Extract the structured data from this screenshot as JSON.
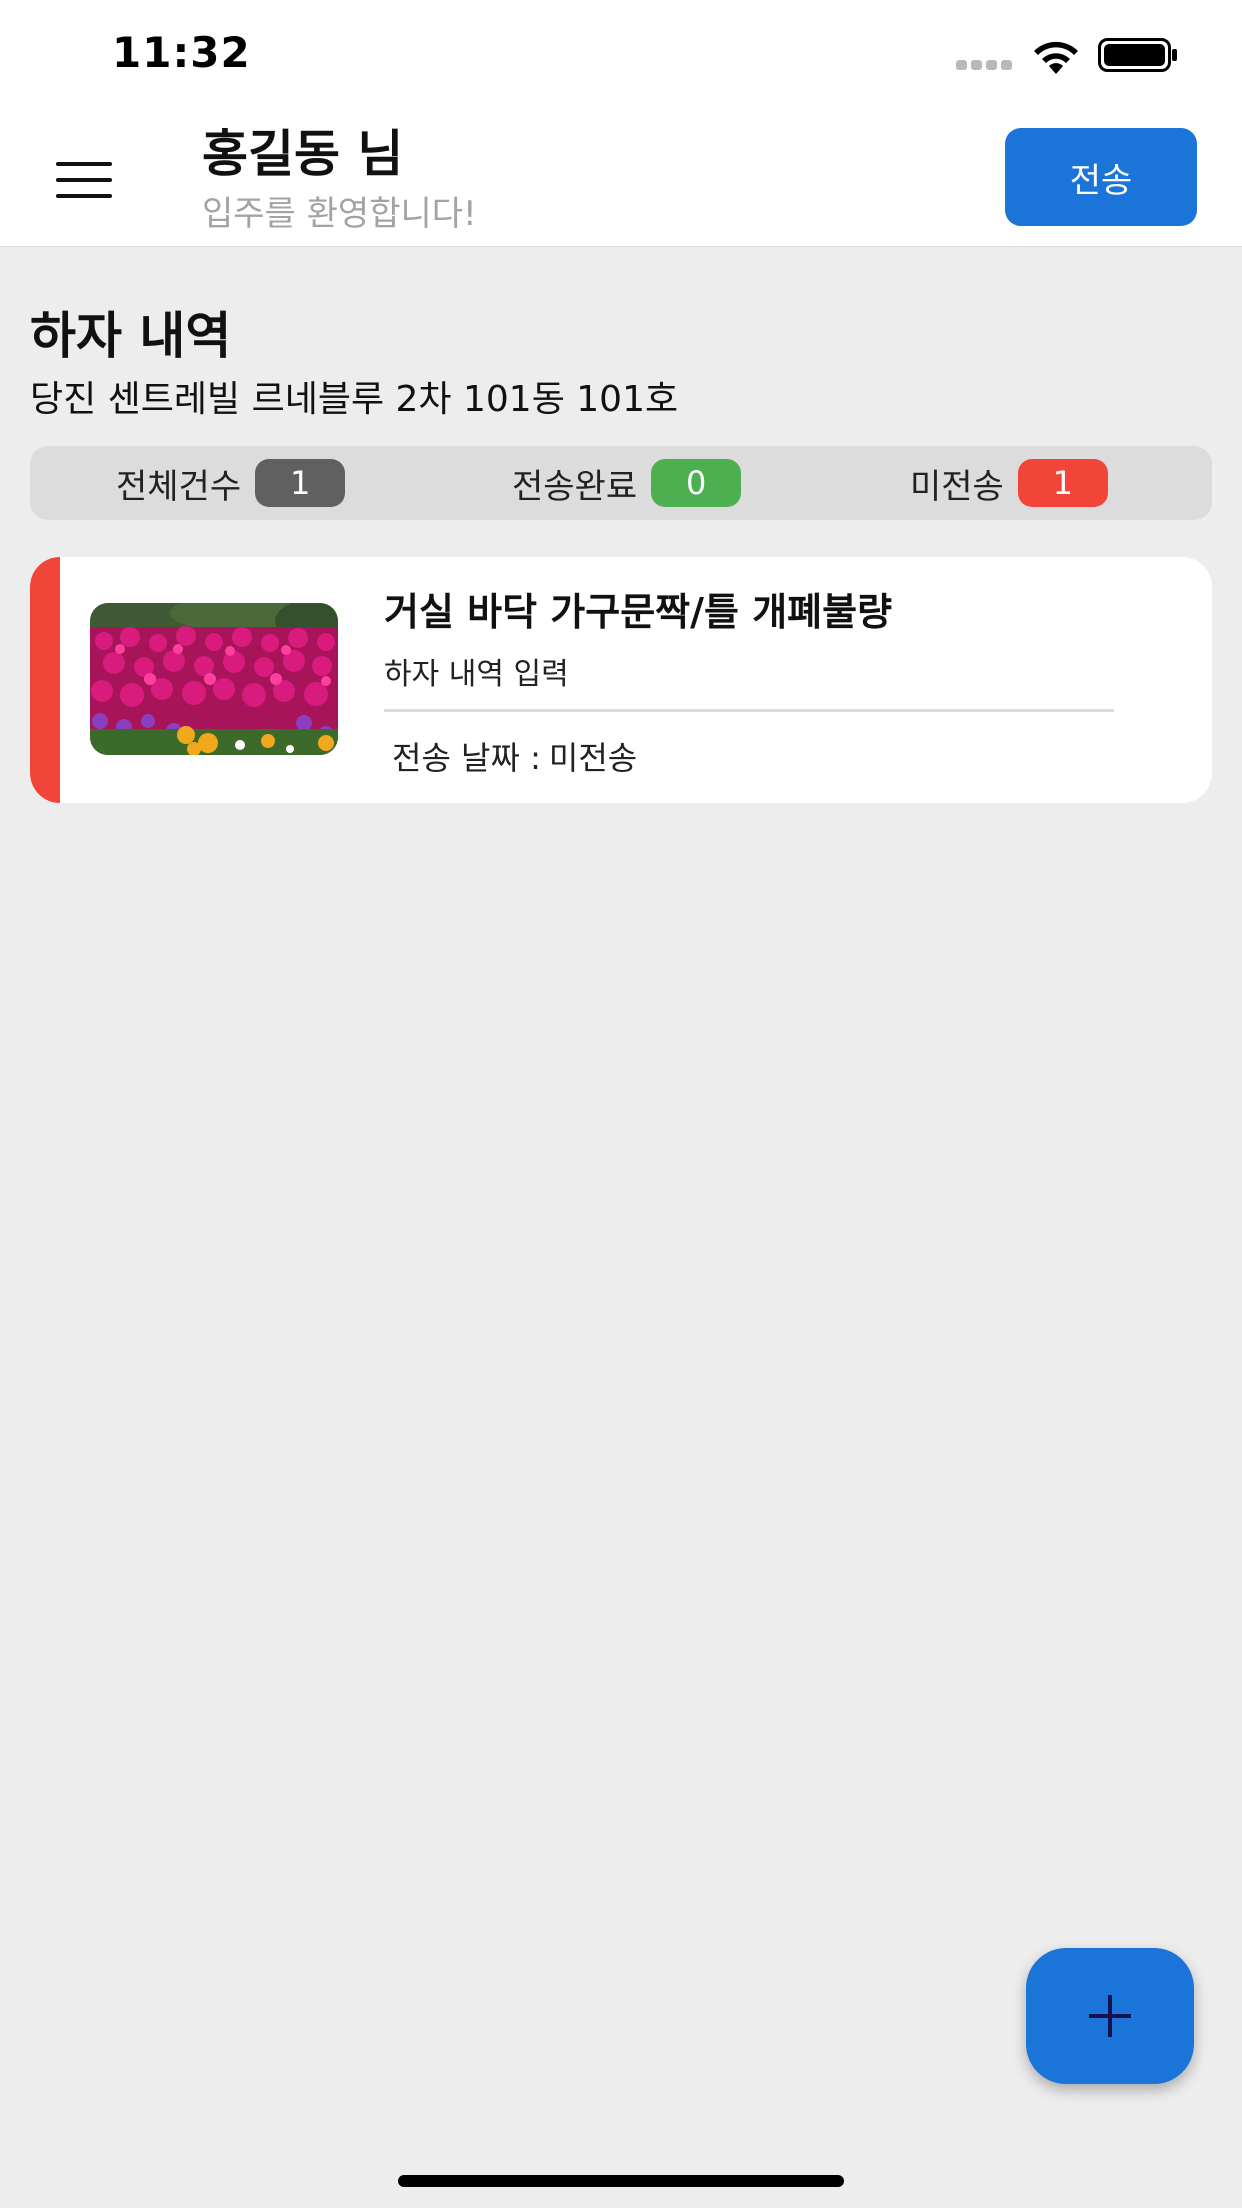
{
  "status_bar": {
    "time": "11:32",
    "wifi_icon": "wifi-icon",
    "battery_icon": "battery-icon",
    "signal_icon": "signal-dots-icon"
  },
  "header": {
    "user_name": "홍길동 님",
    "welcome": "입주를 환영합니다!",
    "send_label": "전송",
    "menu_icon": "hamburger-menu-icon"
  },
  "section": {
    "title": "하자 내역",
    "address": "당진 센트레빌 르네블루 2차 101동 101호"
  },
  "summary": {
    "total_label": "전체건수",
    "total_count": "1",
    "sent_label": "전송완료",
    "sent_count": "0",
    "unsent_label": "미전송",
    "unsent_count": "1",
    "colors": {
      "total": "#606060",
      "sent": "#4caf50",
      "unsent": "#f2453a"
    }
  },
  "records": [
    {
      "title": "거실 바닥 가구문짝/틀 개폐불량",
      "subtitle": "하자 내역 입력",
      "date_label": "전송 날짜 :",
      "date_value": "미전송",
      "status_color": "#f2453a",
      "thumbnail": "flower-field-photo"
    }
  ],
  "fab": {
    "icon": "plus-icon"
  },
  "colors": {
    "accent": "#1b74d8",
    "background": "#ededed"
  }
}
